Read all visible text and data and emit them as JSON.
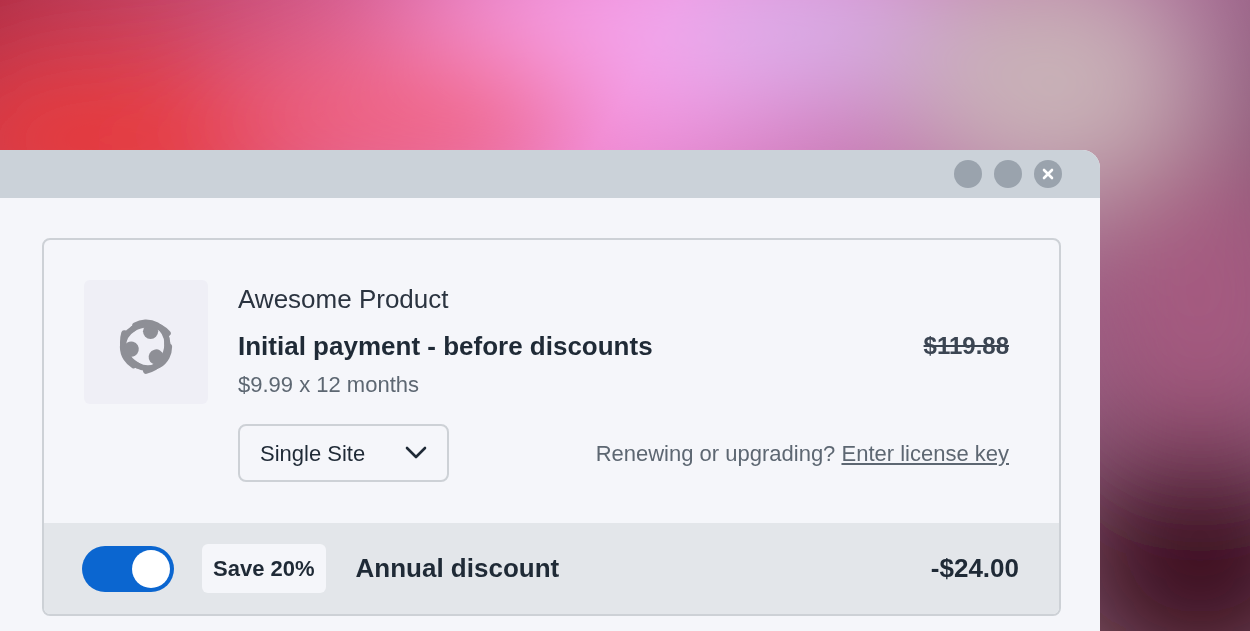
{
  "window": {
    "controls": [
      {
        "kind": "minimize"
      },
      {
        "kind": "maximize"
      },
      {
        "kind": "close"
      }
    ]
  },
  "product": {
    "name": "Awesome Product",
    "heading": "Initial payment - before discounts",
    "original_price": "$119.88",
    "billing": "$9.99 x 12 months",
    "plan": {
      "value": "Single Site"
    },
    "license_prompt": "Renewing or upgrading?",
    "license_link": "Enter license key"
  },
  "discount": {
    "on": true,
    "badge": "Save 20%",
    "label": "Annual discount",
    "amount": "-$24.00"
  }
}
